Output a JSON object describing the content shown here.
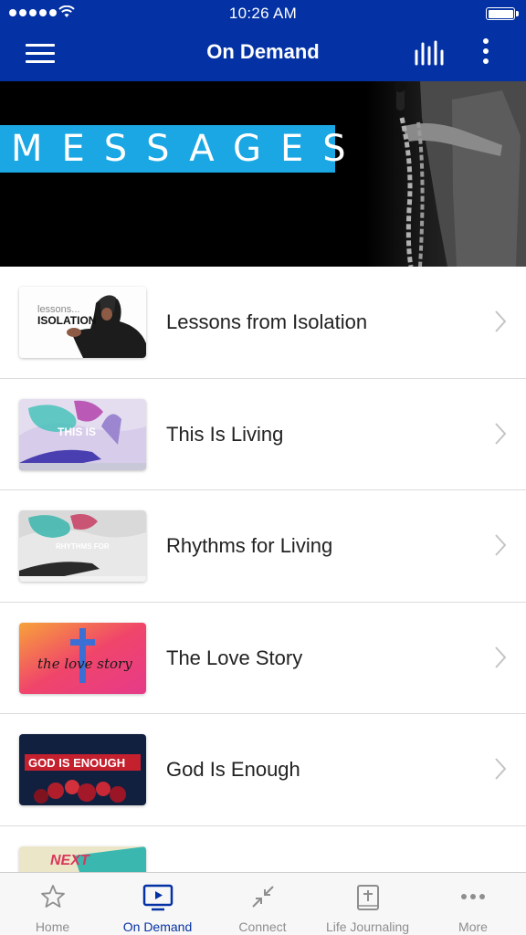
{
  "status_bar": {
    "time": "10:26 AM"
  },
  "nav": {
    "title": "On Demand"
  },
  "banner": {
    "label": "MESSAGES"
  },
  "items": [
    {
      "title": "Lessons from Isolation",
      "thumb_text_1": "lessons...",
      "thumb_text_2": "ISOLATION"
    },
    {
      "title": "This Is Living",
      "thumb_text_1": "THIS IS"
    },
    {
      "title": "Rhythms for Living",
      "thumb_text_1": "RHYTHMS FOR"
    },
    {
      "title": "The Love Story",
      "thumb_text_1": "the love story"
    },
    {
      "title": "God Is Enough",
      "thumb_text_1": "GOD IS ENOUGH"
    },
    {
      "title": "",
      "thumb_text_1": "NEXT"
    }
  ],
  "tabs": [
    {
      "label": "Home",
      "icon": "star-icon"
    },
    {
      "label": "On Demand",
      "icon": "tv-play-icon"
    },
    {
      "label": "Connect",
      "icon": "arrows-in-icon"
    },
    {
      "label": "Life Journaling",
      "icon": "bible-icon"
    },
    {
      "label": "More",
      "icon": "ellipsis-icon"
    }
  ],
  "colors": {
    "nav_blue": "#0432a4",
    "banner_cyan": "#1aa7e4",
    "tab_inactive": "#8e8e8e"
  }
}
